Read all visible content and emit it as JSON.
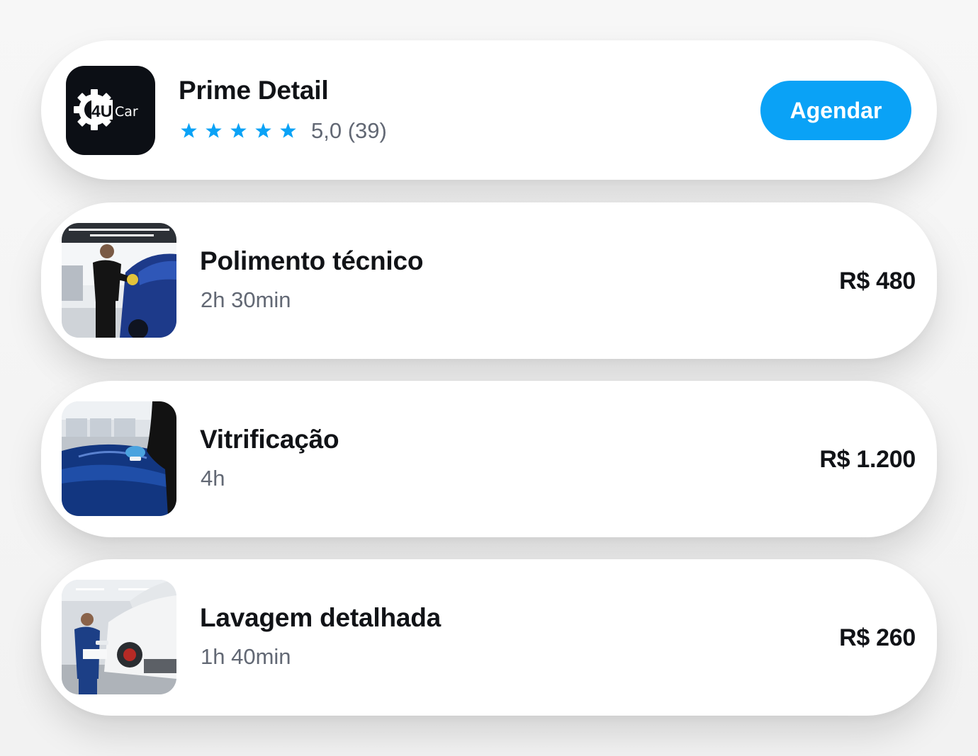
{
  "shop": {
    "logo_text_number": "4U",
    "logo_text_word": "Car",
    "name": "Prime Detail",
    "rating": 5.0,
    "rating_label": "5,0 (39)",
    "stars_filled": 5,
    "stars_total": 5,
    "book_button_label": "Agendar"
  },
  "services": [
    {
      "title": "Polimento técnico",
      "duration": "2h 30min",
      "price": "R$ 480",
      "photo": "technician-polishing-blue-car-photo"
    },
    {
      "title": "Vitrificação",
      "duration": "4h",
      "price": "R$ 1.200",
      "photo": "ceramic-coating-blue-car-hood-photo"
    },
    {
      "title": "Lavagem detalhada",
      "duration": "1h 40min",
      "price": "R$ 260",
      "photo": "foam-wash-white-car-photo"
    }
  ],
  "colors": {
    "accent": "#0aa2f6",
    "star": "#0aa2f6",
    "title_text": "#111317",
    "secondary_text": "#626874",
    "logo_background": "#0c0f15"
  },
  "icons": {
    "logo": "gear-icon",
    "star": "star-icon"
  }
}
